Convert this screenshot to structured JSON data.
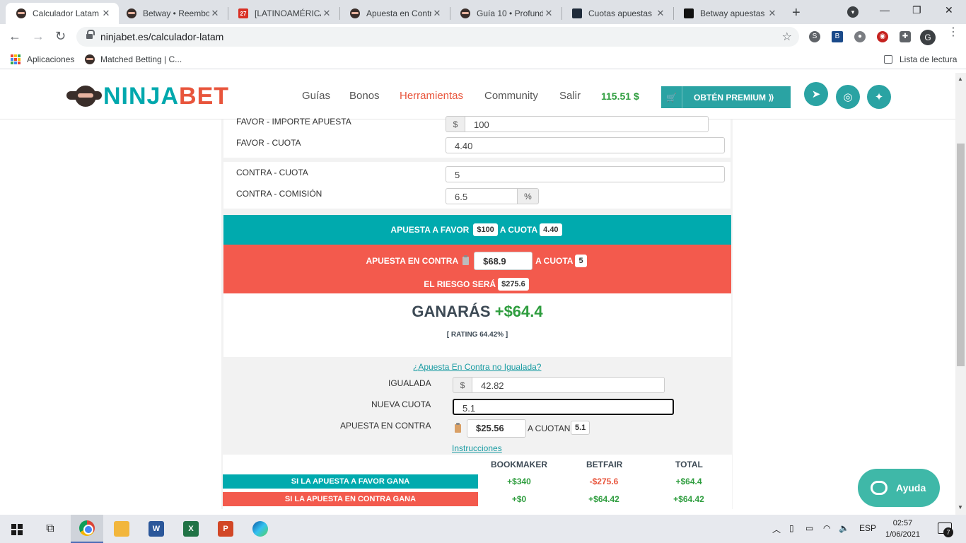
{
  "browser": {
    "tabs": [
      {
        "title": "Calculador Latam",
        "active": true
      },
      {
        "title": "Betway • Reembo"
      },
      {
        "title": "[LATINOAMÉRICA"
      },
      {
        "title": "Apuesta en Contr"
      },
      {
        "title": "Guía 10 • Profund"
      },
      {
        "title": "Cuotas apuestas"
      },
      {
        "title": "Betway apuestas"
      }
    ],
    "url": "ninjabet.es/calculador-latam",
    "bookmarks": {
      "apps": "Aplicaciones",
      "matched": "Matched Betting | C...",
      "reading_list": "Lista de lectura"
    },
    "profile_initial": "G"
  },
  "site": {
    "logo": {
      "part1": "NINJA",
      "part2": "BET"
    },
    "nav": [
      "Guías",
      "Bonos",
      "Herramientas",
      "Community",
      "Salir"
    ],
    "nav_active": "Herramientas",
    "balance": "115.51 $",
    "premium_label": "OBTÉN PREMIUM ⟫",
    "colors": {
      "teal": "#00aaae",
      "red": "#f35a4d",
      "green": "#2e9d3e",
      "accent_orange": "#e8553c"
    }
  },
  "calculator": {
    "favor_importe_label": "FAVOR - IMPORTE APUESTA",
    "favor_importe_prefix": "$",
    "favor_importe_value": "100",
    "favor_cuota_label": "FAVOR - CUOTA",
    "favor_cuota_value": "4.40",
    "contra_cuota_label": "CONTRA - CUOTA",
    "contra_cuota_value": "5",
    "contra_comision_label": "CONTRA - COMISIÓN",
    "contra_comision_value": "6.5",
    "contra_comision_suffix": "%",
    "summary": {
      "favor_text": "APUESTA A FAVOR",
      "favor_amount": "$100",
      "a_cuota": "A CUOTA",
      "favor_odds": "4.40",
      "contra_text": "APUESTA EN CONTRA",
      "contra_amount": "$68.9",
      "contra_odds": "5",
      "riesgo_text": "EL RIESGO SERÁ",
      "riesgo_amount": "$275.6"
    },
    "result": {
      "ganaras_label": "GANARÁS",
      "ganaras_value": "+$64.4",
      "rating": "[ RATING 64.42% ]"
    },
    "unmatched": {
      "link": "¿Apuesta En Contra no Igualada?",
      "igualada_label": "IGUALADA",
      "igualada_prefix": "$",
      "igualada_value": "42.82",
      "nueva_cuota_label": "NUEVA CUOTA",
      "nueva_cuota_value": "5.1",
      "apuesta_contra_label": "APUESTA EN CONTRA",
      "apuesta_contra_value": "$25.56",
      "a_cuotan": "A CUOTAN",
      "cuotan_value": "5.1",
      "instrucciones": "Instrucciones"
    },
    "table": {
      "headers": [
        "BOOKMAKER",
        "BETFAIR",
        "TOTAL"
      ],
      "rows": [
        {
          "label": "SI LA APUESTA A FAVOR GANA",
          "bookmaker": "+$340",
          "betfair": "-$275.6",
          "total": "+$64.4"
        },
        {
          "label": "SI LA APUESTA EN CONTRA GANA",
          "bookmaker": "+$0",
          "betfair": "+$64.42",
          "total": "+$64.42"
        }
      ]
    }
  },
  "help_button": "Ayuda",
  "taskbar": {
    "language": "ESP",
    "time": "02:57",
    "date": "1/06/2021",
    "notifications": "7"
  }
}
